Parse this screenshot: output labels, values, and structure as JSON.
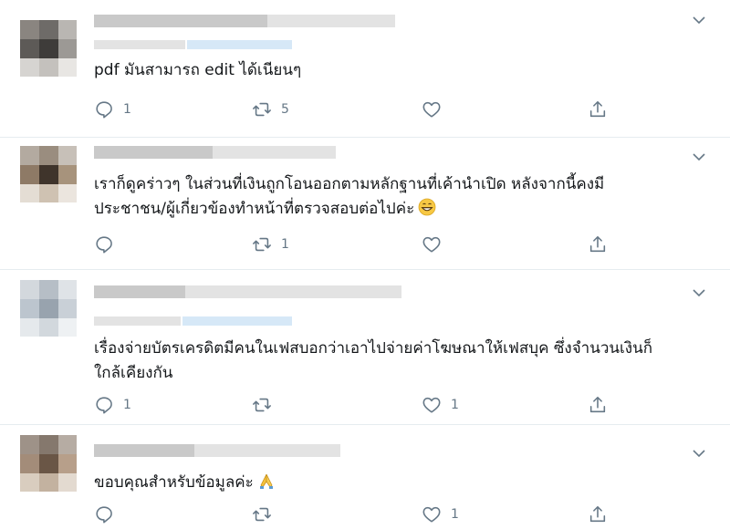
{
  "tweets": [
    {
      "text_lines": [
        "pdf มันสามารถ edit ได้เนียนๆ"
      ],
      "reply_count": "1",
      "retweet_count": "5",
      "like_count": "",
      "emoji": ""
    },
    {
      "text_lines": [
        "เราก็ดูคร่าวๆ ในส่วนที่เงินถูกโอนออกตามหลักฐานที่เค้านำเปิด หลังจากนี้คงมี",
        "ประชาชน/ผู้เกี่ยวข้องทำหน้าที่ตรวจสอบต่อไปค่ะ"
      ],
      "reply_count": "",
      "retweet_count": "1",
      "like_count": "",
      "emoji": "grinning-face-emoji"
    },
    {
      "text_lines": [
        "เรื่องจ่ายบัตรเครดิตมีคนในเฟสบอกว่าเอาไปจ่ายค่าโฆษณาให้เฟสบุค ซึ่งจำนวนเงินก็",
        "ใกล้เคียงกัน"
      ],
      "reply_count": "1",
      "retweet_count": "",
      "like_count": "1",
      "emoji": ""
    },
    {
      "text_lines": [
        "ขอบคุณสำหรับข้อมูลค่ะ"
      ],
      "reply_count": "",
      "retweet_count": "",
      "like_count": "1",
      "emoji": "folded-hands-emoji"
    }
  ],
  "colors": {
    "icon": "#657786",
    "divider": "#e6ecf0",
    "text": "#14171a"
  }
}
